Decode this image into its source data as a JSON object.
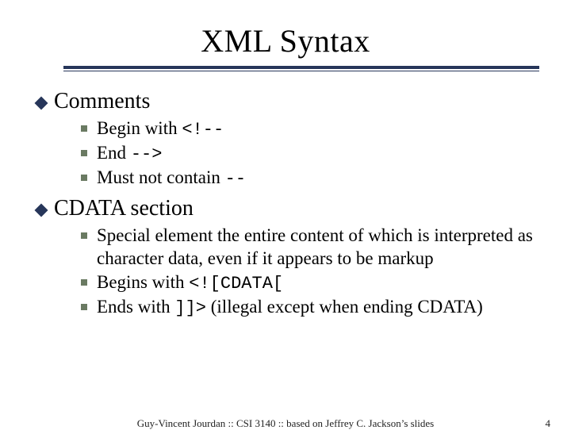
{
  "title": "XML Syntax",
  "sections": [
    {
      "heading": "Comments",
      "items": [
        {
          "prefix": "Begin with ",
          "code": "<!--",
          "suffix": ""
        },
        {
          "prefix": "End ",
          "code": "-->",
          "suffix": ""
        },
        {
          "prefix": "Must not contain ",
          "code": "--",
          "suffix": ""
        }
      ]
    },
    {
      "heading": "CDATA section",
      "items": [
        {
          "prefix": "Special element the entire content of which is interpreted as character data, even if it appears to be markup",
          "code": "",
          "suffix": ""
        },
        {
          "prefix": "Begins with ",
          "code": "<![CDATA[",
          "suffix": ""
        },
        {
          "prefix": "Ends with ",
          "code": "]]>",
          "suffix": " (illegal except when ending CDATA)"
        }
      ]
    }
  ],
  "footer": {
    "center": "Guy-Vincent Jourdan :: CSI 3140 :: based on Jeffrey C. Jackson’s slides",
    "pageNumber": "4"
  }
}
